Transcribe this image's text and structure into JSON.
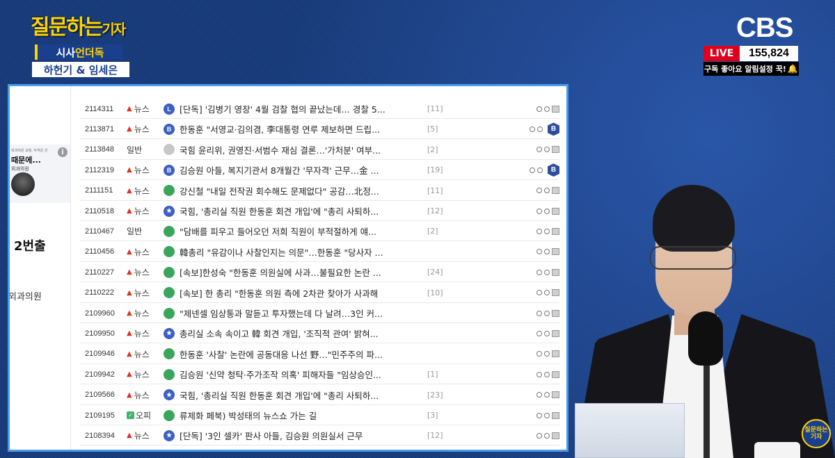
{
  "show": {
    "title_main": "질문하는",
    "title_small": "기자",
    "segment_part1": "시사",
    "segment_part2": "언더독",
    "hosts": "하헌기 & 임세은"
  },
  "broadcast": {
    "channel": "CBS",
    "live_label": "LIVE",
    "viewer_count": "155,824",
    "subscribe_text": "구독 좋아요 알림설정 꾹!"
  },
  "sidebar": {
    "heading": "2번출",
    "subtext": "외과의원",
    "ad": {
      "line1": "외과의원 교정, 두꺼운 선",
      "line2": "때문에...",
      "line3": "외과의원"
    }
  },
  "colors": {
    "live_red": "#e0001b",
    "brand_yellow": "#ffd400",
    "panel_border": "#4a9bf0"
  },
  "posts": [
    {
      "id": "2114311",
      "category": "뉴스",
      "badge": "L",
      "badge_color": "blue",
      "title": "[단독] '김병기 영장' 4월 검찰 협의 끝났는데… 경찰 5...",
      "count": "[11]",
      "shield": ""
    },
    {
      "id": "2113871",
      "category": "뉴스",
      "badge": "B",
      "badge_color": "blue",
      "title": "한동훈 \"서영교·김의겸, 李대통령 연루 제보하면 드립...",
      "count": "[5]",
      "shield": "B"
    },
    {
      "id": "2113848",
      "category": "일반",
      "badge": "",
      "badge_color": "gray",
      "title": "국힘 윤리위, 권영진·서범수 재심 결론…'가처분' 여부...",
      "count": "[2]",
      "shield": ""
    },
    {
      "id": "2112319",
      "category": "뉴스",
      "badge": "B",
      "badge_color": "blue",
      "title": "김승원 아들, 복지기관서 8개월간 '무자격' 근무…金 ...",
      "count": "[19]",
      "shield": "B"
    },
    {
      "id": "2111151",
      "category": "뉴스",
      "badge": "",
      "badge_color": "green",
      "title": "강신철 \"내일 전작권 회수해도 문제없다\" 공감…北정...",
      "count": "[11]",
      "shield": ""
    },
    {
      "id": "2110518",
      "category": "뉴스",
      "badge": "★",
      "badge_color": "blue",
      "title": "국힘, '총리실 직원 한동훈 회견 개입'에 \"총리 사퇴하...",
      "count": "[12]",
      "shield": ""
    },
    {
      "id": "2110467",
      "category": "일반",
      "badge": "",
      "badge_color": "green",
      "title": "\"담배를 피우고 들어오던 저희 직원이 부적절하게 얘...",
      "count": "[2]",
      "shield": ""
    },
    {
      "id": "2110456",
      "category": "뉴스",
      "badge": "",
      "badge_color": "green",
      "title": "韓총리 \"유감이나 사찰인지는 의문\"…한동훈 \"당사자 ...",
      "count": "",
      "shield": ""
    },
    {
      "id": "2110227",
      "category": "뉴스",
      "badge": "",
      "badge_color": "green",
      "title": "[속보]한성숙 \"한동훈 의원실에 사과…불필요한 논란 ...",
      "count": "[24]",
      "shield": ""
    },
    {
      "id": "2110222",
      "category": "뉴스",
      "badge": "",
      "badge_color": "green",
      "title": "[속보] 한 총리 \"한동훈 의원 측에 2차관 찾아가 사과해",
      "count": "[10]",
      "shield": ""
    },
    {
      "id": "2109960",
      "category": "뉴스",
      "badge": "",
      "badge_color": "green",
      "title": "\"제넨셀 임상통과 말듣고 투자했는데 다 날려…3인 커...",
      "count": "",
      "shield": ""
    },
    {
      "id": "2109950",
      "category": "뉴스",
      "badge": "★",
      "badge_color": "blue",
      "title": "총리실 소속 속이고 韓 회견 개입, '조직적 관여' 밝혀...",
      "count": "",
      "shield": ""
    },
    {
      "id": "2109946",
      "category": "뉴스",
      "badge": "",
      "badge_color": "green",
      "title": "한동훈 '사찰' 논란에 공동대응 나선 野…\"민주주의 파...",
      "count": "",
      "shield": ""
    },
    {
      "id": "2109942",
      "category": "뉴스",
      "badge": "",
      "badge_color": "green",
      "title": "김승원 '신약 청탁·주가조작 의혹' 피해자들 \"임상승인...",
      "count": "[1]",
      "shield": ""
    },
    {
      "id": "2109566",
      "category": "뉴스",
      "badge": "★",
      "badge_color": "blue",
      "title": "국힘, '총리실 직원 한동훈 회견 개입'에 \"총리 사퇴하...",
      "count": "[23]",
      "shield": ""
    },
    {
      "id": "2109195",
      "category": "오피",
      "badge": "",
      "badge_color": "green",
      "title": "류제화 페북) 박성태의 뉴스쇼 가는 길",
      "count": "[3]",
      "shield": ""
    },
    {
      "id": "2108394",
      "category": "뉴스",
      "badge": "★",
      "badge_color": "blue",
      "title": "[단독] '3인 셀카' 판사 아들, 김승원 의원실서 근무",
      "count": "[12]",
      "shield": ""
    }
  ],
  "corner_logo": "질문하는 기자"
}
